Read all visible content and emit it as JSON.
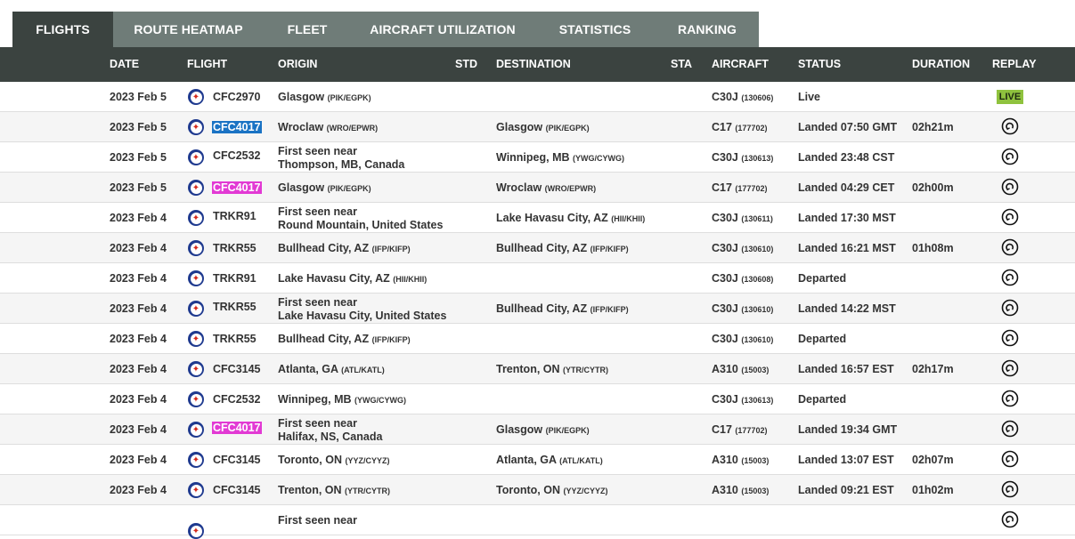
{
  "tabs": [
    {
      "label": "FLIGHTS",
      "active": true
    },
    {
      "label": "ROUTE HEATMAP",
      "active": false
    },
    {
      "label": "FLEET",
      "active": false
    },
    {
      "label": "AIRCRAFT UTILIZATION",
      "active": false
    },
    {
      "label": "STATISTICS",
      "active": false
    },
    {
      "label": "RANKING",
      "active": false
    }
  ],
  "columns": {
    "date": "DATE",
    "flight": "FLIGHT",
    "origin": "ORIGIN",
    "std": "STD",
    "destination": "DESTINATION",
    "sta": "STA",
    "aircraft": "AIRCRAFT",
    "status": "STATUS",
    "duration": "DURATION",
    "replay": "REPLAY"
  },
  "colors": {
    "header_bg": "#3b4340",
    "tab_bg": "#6f7c78",
    "live": "#8fc23e",
    "highlight_blue": "#1a73c4",
    "highlight_pink": "#e23ad4"
  },
  "icons": {
    "flag": "canada-roundel-icon",
    "replay": "replay-icon"
  },
  "rows": [
    {
      "date": "2023 Feb 5",
      "flight": "CFC2970",
      "hl": "",
      "origin_l1": "Glasgow",
      "origin_code": "(PIK/EGPK)",
      "origin_l2": "",
      "dest": "",
      "dest_code": "",
      "aircraft": "C30J",
      "reg": "(130606)",
      "status": "Live",
      "duration": "",
      "replay": "live",
      "live_label": "LIVE"
    },
    {
      "date": "2023 Feb 5",
      "flight": "CFC4017",
      "hl": "blue",
      "origin_l1": "Wroclaw",
      "origin_code": "(WRO/EPWR)",
      "origin_l2": "",
      "dest": "Glasgow",
      "dest_code": "(PIK/EGPK)",
      "aircraft": "C17",
      "reg": "(177702)",
      "status": "Landed 07:50 GMT",
      "duration": "02h21m",
      "replay": "icon"
    },
    {
      "date": "2023 Feb 5",
      "flight": "CFC2532",
      "hl": "",
      "origin_l1": "First seen near",
      "origin_code": "",
      "origin_l2": "Thompson, MB, Canada",
      "dest": "Winnipeg, MB",
      "dest_code": "(YWG/CYWG)",
      "aircraft": "C30J",
      "reg": "(130613)",
      "status": "Landed 23:48 CST",
      "duration": "",
      "replay": "icon"
    },
    {
      "date": "2023 Feb 5",
      "flight": "CFC4017",
      "hl": "pink",
      "origin_l1": "Glasgow",
      "origin_code": "(PIK/EGPK)",
      "origin_l2": "",
      "dest": "Wroclaw",
      "dest_code": "(WRO/EPWR)",
      "aircraft": "C17",
      "reg": "(177702)",
      "status": "Landed 04:29 CET",
      "duration": "02h00m",
      "replay": "icon"
    },
    {
      "date": "2023 Feb 4",
      "flight": "TRKR91",
      "hl": "",
      "origin_l1": "First seen near",
      "origin_code": "",
      "origin_l2": "Round Mountain, United States",
      "dest": "Lake Havasu City, AZ",
      "dest_code": "(HII/KHII)",
      "aircraft": "C30J",
      "reg": "(130611)",
      "status": "Landed 17:30 MST",
      "duration": "",
      "replay": "icon"
    },
    {
      "date": "2023 Feb 4",
      "flight": "TRKR55",
      "hl": "",
      "origin_l1": "Bullhead City, AZ",
      "origin_code": "(IFP/KIFP)",
      "origin_l2": "",
      "dest": "Bullhead City, AZ",
      "dest_code": "(IFP/KIFP)",
      "aircraft": "C30J",
      "reg": "(130610)",
      "status": "Landed 16:21 MST",
      "duration": "01h08m",
      "replay": "icon"
    },
    {
      "date": "2023 Feb 4",
      "flight": "TRKR91",
      "hl": "",
      "origin_l1": "Lake Havasu City, AZ",
      "origin_code": "(HII/KHII)",
      "origin_l2": "",
      "dest": "",
      "dest_code": "",
      "aircraft": "C30J",
      "reg": "(130608)",
      "status": "Departed",
      "duration": "",
      "replay": "icon"
    },
    {
      "date": "2023 Feb 4",
      "flight": "TRKR55",
      "hl": "",
      "origin_l1": "First seen near",
      "origin_code": "",
      "origin_l2": "Lake Havasu City, United States",
      "dest": "Bullhead City, AZ",
      "dest_code": "(IFP/KIFP)",
      "aircraft": "C30J",
      "reg": "(130610)",
      "status": "Landed 14:22 MST",
      "duration": "",
      "replay": "icon"
    },
    {
      "date": "2023 Feb 4",
      "flight": "TRKR55",
      "hl": "",
      "origin_l1": "Bullhead City, AZ",
      "origin_code": "(IFP/KIFP)",
      "origin_l2": "",
      "dest": "",
      "dest_code": "",
      "aircraft": "C30J",
      "reg": "(130610)",
      "status": "Departed",
      "duration": "",
      "replay": "icon"
    },
    {
      "date": "2023 Feb 4",
      "flight": "CFC3145",
      "hl": "",
      "origin_l1": "Atlanta, GA",
      "origin_code": "(ATL/KATL)",
      "origin_l2": "",
      "dest": "Trenton, ON",
      "dest_code": "(YTR/CYTR)",
      "aircraft": "A310",
      "reg": "(15003)",
      "status": "Landed 16:57 EST",
      "duration": "02h17m",
      "replay": "icon"
    },
    {
      "date": "2023 Feb 4",
      "flight": "CFC2532",
      "hl": "",
      "origin_l1": "Winnipeg, MB",
      "origin_code": "(YWG/CYWG)",
      "origin_l2": "",
      "dest": "",
      "dest_code": "",
      "aircraft": "C30J",
      "reg": "(130613)",
      "status": "Departed",
      "duration": "",
      "replay": "icon"
    },
    {
      "date": "2023 Feb 4",
      "flight": "CFC4017",
      "hl": "pink",
      "origin_l1": "First seen near",
      "origin_code": "",
      "origin_l2": "Halifax, NS, Canada",
      "dest": "Glasgow",
      "dest_code": "(PIK/EGPK)",
      "aircraft": "C17",
      "reg": "(177702)",
      "status": "Landed 19:34 GMT",
      "duration": "",
      "replay": "icon"
    },
    {
      "date": "2023 Feb 4",
      "flight": "CFC3145",
      "hl": "",
      "origin_l1": "Toronto, ON",
      "origin_code": "(YYZ/CYYZ)",
      "origin_l2": "",
      "dest": "Atlanta, GA",
      "dest_code": "(ATL/KATL)",
      "aircraft": "A310",
      "reg": "(15003)",
      "status": "Landed 13:07 EST",
      "duration": "02h07m",
      "replay": "icon"
    },
    {
      "date": "2023 Feb 4",
      "flight": "CFC3145",
      "hl": "",
      "origin_l1": "Trenton, ON",
      "origin_code": "(YTR/CYTR)",
      "origin_l2": "",
      "dest": "Toronto, ON",
      "dest_code": "(YYZ/CYYZ)",
      "aircraft": "A310",
      "reg": "(15003)",
      "status": "Landed 09:21 EST",
      "duration": "01h02m",
      "replay": "icon"
    },
    {
      "date": "",
      "flight": "",
      "hl": "",
      "origin_l1": "First seen near",
      "origin_code": "",
      "origin_l2": "",
      "dest": "",
      "dest_code": "",
      "aircraft": "",
      "reg": "",
      "status": "",
      "duration": "",
      "replay": "icon"
    }
  ]
}
